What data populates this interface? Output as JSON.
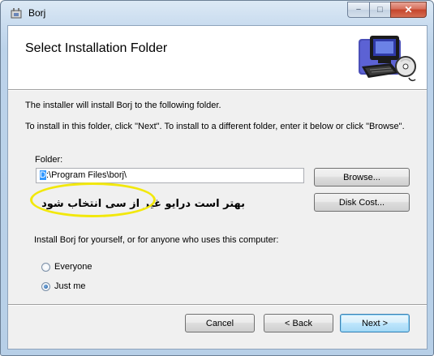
{
  "window": {
    "title": "Borj",
    "minimize_symbol": "−",
    "maximize_symbol": "□",
    "close_symbol": "✕"
  },
  "banner": {
    "title": "Select Installation Folder",
    "art_icon": "computer-cd-icon"
  },
  "body": {
    "intro": "The installer will install Borj to the following folder.",
    "instruction": "To install in this folder, click \"Next\". To install to a different folder, enter it below or click \"Browse\".",
    "folder_label": "Folder:",
    "folder_value_selected": "D",
    "folder_value_rest": ":\\Program Files\\borj\\",
    "browse_label": "Browse...",
    "disk_cost_label": "Disk Cost...",
    "persian_note": "بهتر است درایو غیر از سی انتخاب شود",
    "install_for_label": "Install Borj for yourself, or for anyone who uses this computer:",
    "radio_options": [
      {
        "label": "Everyone",
        "selected": false
      },
      {
        "label": "Just me",
        "selected": true
      }
    ]
  },
  "footer": {
    "cancel_label": "Cancel",
    "back_label": "< Back",
    "next_label": "Next >"
  },
  "colors": {
    "highlight": "#f2e80b",
    "selection": "#3399ff"
  }
}
